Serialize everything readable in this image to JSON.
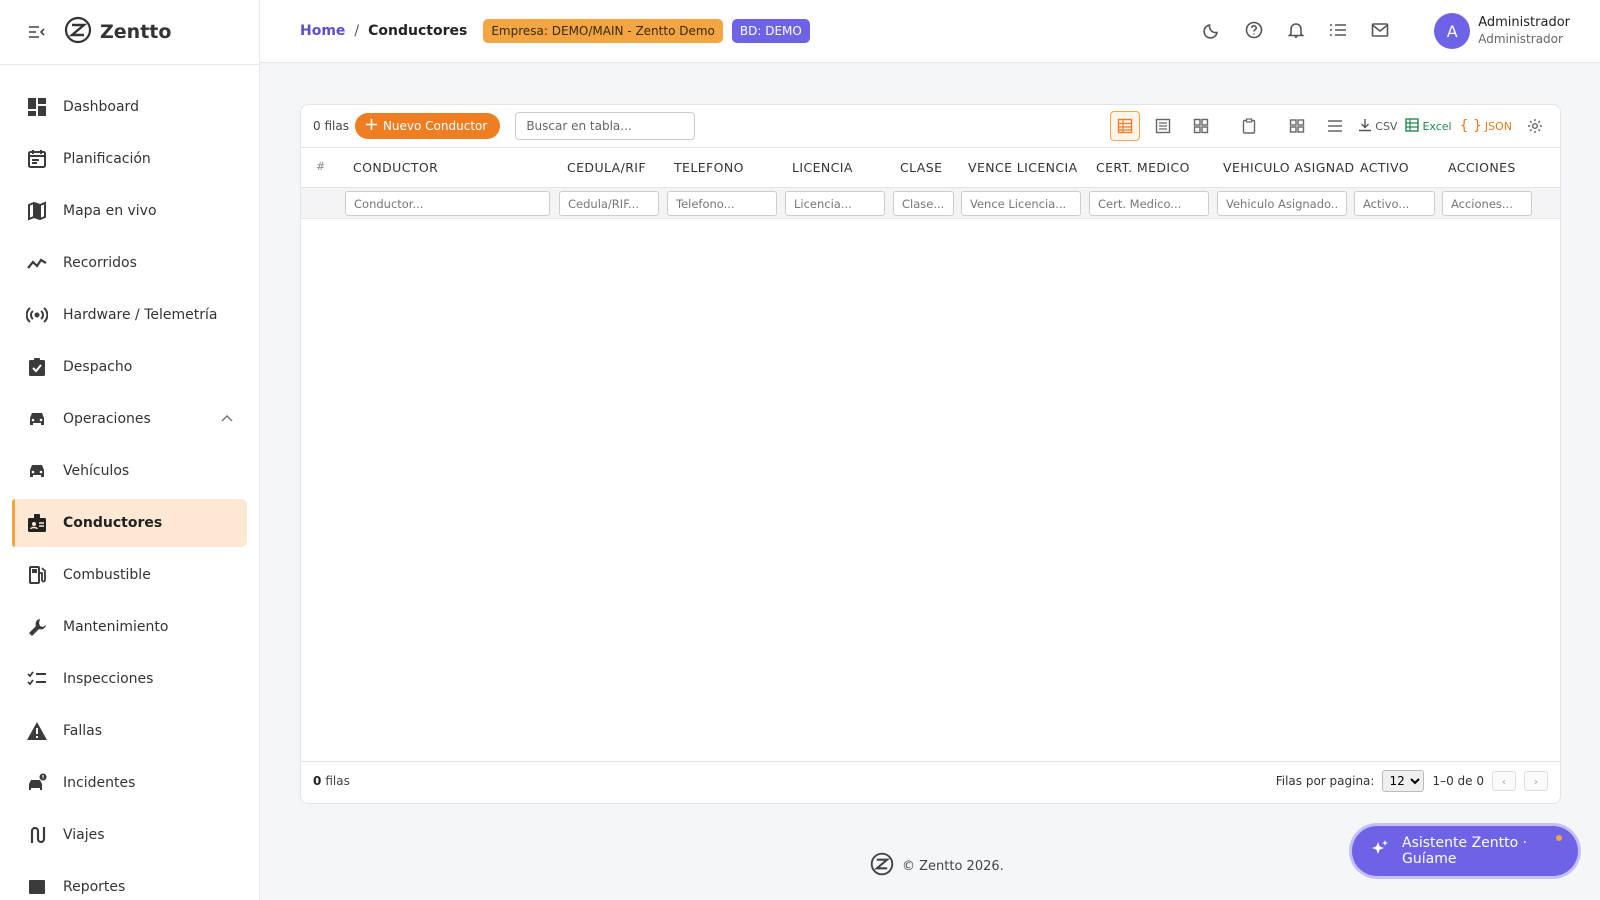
{
  "brand": {
    "name": "Zentto"
  },
  "sidebar": {
    "items": [
      {
        "label": "Dashboard",
        "icon": "dashboard-icon"
      },
      {
        "label": "Planificación",
        "icon": "calendar-icon"
      },
      {
        "label": "Mapa en vivo",
        "icon": "map-icon"
      },
      {
        "label": "Recorridos",
        "icon": "trend-line-icon"
      },
      {
        "label": "Hardware / Telemetría",
        "icon": "broadcast-icon"
      },
      {
        "label": "Despacho",
        "icon": "clipboard-check-icon"
      },
      {
        "label": "Operaciones",
        "icon": "car-icon",
        "expanded": true
      },
      {
        "label": "Vehículos",
        "icon": "car-icon"
      },
      {
        "label": "Conductores",
        "icon": "id-badge-icon",
        "active": true
      },
      {
        "label": "Combustible",
        "icon": "fuel-icon"
      },
      {
        "label": "Mantenimiento",
        "icon": "wrench-icon"
      },
      {
        "label": "Inspecciones",
        "icon": "checklist-icon"
      },
      {
        "label": "Fallas",
        "icon": "warning-icon"
      },
      {
        "label": "Incidentes",
        "icon": "incident-icon"
      },
      {
        "label": "Viajes",
        "icon": "route-icon"
      },
      {
        "label": "Reportes",
        "icon": "report-icon"
      }
    ]
  },
  "header": {
    "breadcrumb_home": "Home",
    "breadcrumb_sep": "/",
    "breadcrumb_current": "Conductores",
    "badge_empresa": "Empresa: DEMO/MAIN - Zentto Demo",
    "badge_bd": "BD: DEMO",
    "user_initial": "A",
    "user_name": "Administrador",
    "user_role": "Administrador"
  },
  "table": {
    "rows_count": "0 filas",
    "new_button": "Nuevo Conductor",
    "search_placeholder": "Buscar en tabla...",
    "export_csv": "CSV",
    "export_excel": "Excel",
    "export_json": "JSON",
    "hash": "#",
    "columns": [
      {
        "label": "CONDUCTOR",
        "filter": "Conductor..."
      },
      {
        "label": "CEDULA/RIF",
        "filter": "Cedula/RIF..."
      },
      {
        "label": "TELEFONO",
        "filter": "Telefono..."
      },
      {
        "label": "LICENCIA",
        "filter": "Licencia..."
      },
      {
        "label": "CLASE",
        "filter": "Clase..."
      },
      {
        "label": "VENCE LICENCIA",
        "filter": "Vence Licencia..."
      },
      {
        "label": "CERT. MEDICO",
        "filter": "Cert. Medico..."
      },
      {
        "label": "VEHICULO ASIGNAD",
        "filter": "Vehiculo Asignado..."
      },
      {
        "label": "ACTIVO",
        "filter": "Activo..."
      },
      {
        "label": "ACCIONES",
        "filter": "Acciones..."
      }
    ],
    "footer_count": "0",
    "footer_label": "filas",
    "rows_per_page_label": "Filas por pagina:",
    "rows_per_page": "12",
    "range": "1–0 de 0"
  },
  "footer": {
    "text": "© Zentto 2026."
  },
  "assistant": {
    "label": "Asistente Zentto · Guíame"
  },
  "colors": {
    "accent": "#6e63e6",
    "orange": "#ef7d22",
    "active_bg": "#fde9d3"
  }
}
